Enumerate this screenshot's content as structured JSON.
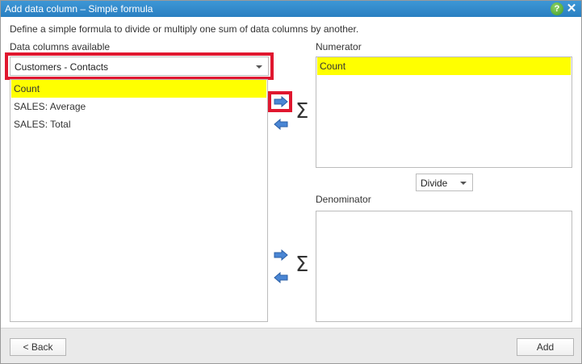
{
  "window": {
    "title": "Add data column – Simple formula",
    "help": "?",
    "close": "✕"
  },
  "description": "Define a simple formula to divide or multiply one sum of data columns by another.",
  "left": {
    "label": "Data columns available",
    "source_select": "Customers - Contacts",
    "items": [
      {
        "label": "Count",
        "selected": true
      },
      {
        "label": "SALES: Average",
        "selected": false
      },
      {
        "label": "SALES: Total",
        "selected": false
      }
    ]
  },
  "numerator": {
    "label": "Numerator",
    "items": [
      {
        "label": "Count",
        "selected": true
      }
    ]
  },
  "operation_select": "Divide",
  "denominator": {
    "label": "Denominator",
    "items": []
  },
  "sigma": "Σ",
  "footer": {
    "back_label": "< Back",
    "add_label": "Add"
  },
  "colors": {
    "title_bar": "#2a7fc1",
    "selection": "#ffff00",
    "highlight": "#e0172f",
    "arrow": "#4a86d4"
  }
}
